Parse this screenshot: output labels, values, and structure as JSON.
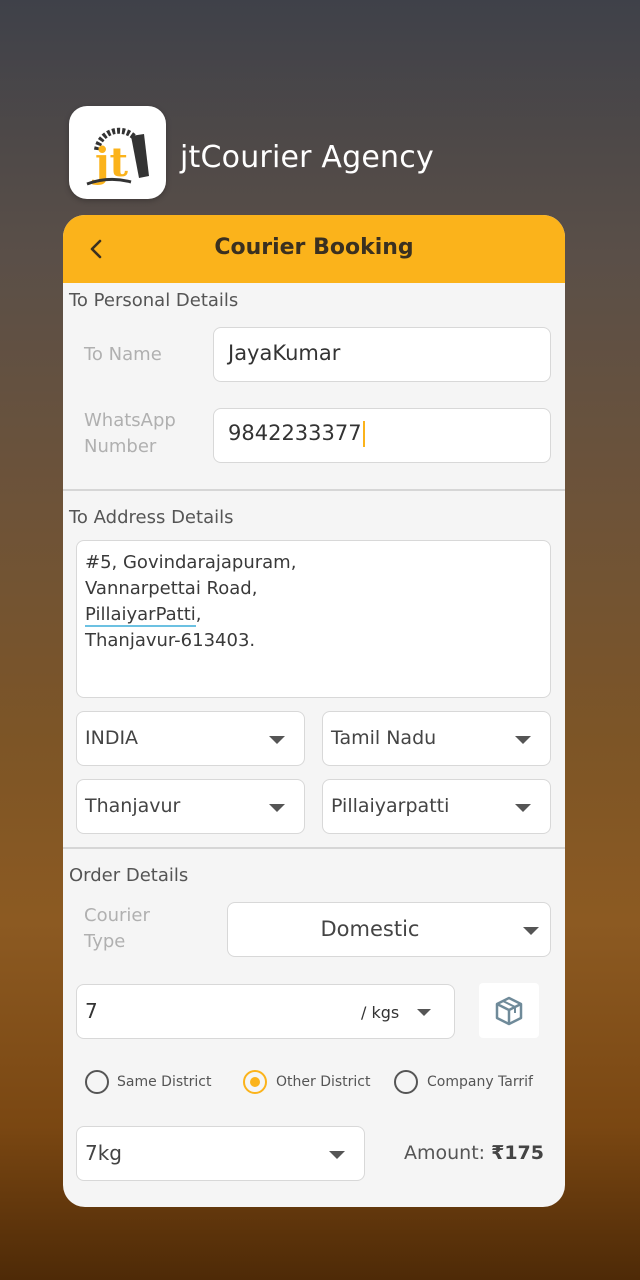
{
  "app": {
    "name": "jtCourier Agency",
    "icon": "jt-courier-logo"
  },
  "header": {
    "title": "Courier Booking",
    "back_icon": "chevron-left-icon"
  },
  "personal": {
    "section_title": "To Personal Details",
    "name_label": "To Name",
    "name_value": "JayaKumar",
    "whatsapp_label_line1": "WhatsApp",
    "whatsapp_label_line2": "Number",
    "whatsapp_value": "9842233377"
  },
  "address": {
    "section_title": "To Address Details",
    "lines": [
      "#5, Govindarajapuram,",
      "Vannarpettai Road,",
      "PillaiyarPatti",
      ",",
      "Thanjavur-613403."
    ],
    "country": "INDIA",
    "state": "Tamil Nadu",
    "district": "Thanjavur",
    "town": "Pillaiyarpatti"
  },
  "order": {
    "section_title": "Order Details",
    "courier_type_label_line1": "Courier",
    "courier_type_label_line2": "Type",
    "courier_type_value": "Domestic",
    "weight_value": "7",
    "weight_unit": "/ kgs",
    "package_icon": "box-icon",
    "radios": [
      {
        "label": "Same District",
        "selected": false
      },
      {
        "label": "Other District",
        "selected": true
      },
      {
        "label": "Company Tarrif",
        "selected": false
      }
    ],
    "weight_slab": "7kg",
    "amount_label": "Amount: ",
    "amount_value": "₹175"
  },
  "colors": {
    "accent": "#fbb31b",
    "card_bg": "#f5f5f5"
  }
}
